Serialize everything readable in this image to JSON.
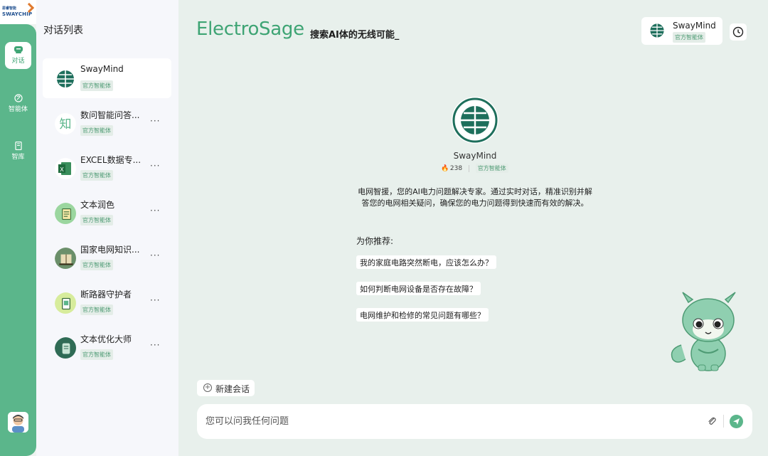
{
  "rail": {
    "logo_top": "思睿智能",
    "logo_bottom": "SWAYCHIP",
    "items": [
      {
        "label": "对话",
        "icon": "chat-icon",
        "active": true
      },
      {
        "label": "智能体",
        "icon": "brain-icon",
        "active": false
      },
      {
        "label": "智库",
        "icon": "book-icon",
        "active": false
      }
    ]
  },
  "sidebar": {
    "title": "对话列表",
    "conversations": [
      {
        "name": "SwayMind",
        "tag": "官方智能体",
        "active": true
      },
      {
        "name": "数问智能问答...",
        "tag": "官方智能体"
      },
      {
        "name": "EXCEL数据专...",
        "tag": "官方智能体"
      },
      {
        "name": "文本润色",
        "tag": "官方智能体"
      },
      {
        "name": "国家电网知识...",
        "tag": "官方智能体"
      },
      {
        "name": "断路器守护者",
        "tag": "官方智能体"
      },
      {
        "name": "文本优化大师",
        "tag": "官方智能体"
      }
    ],
    "more_label": "···"
  },
  "header": {
    "brand": "ElectroSage",
    "tagline": "搜索AI体的无线可能_",
    "agent_name": "SwayMind",
    "agent_tag": "官方智能体"
  },
  "intro": {
    "name": "SwayMind",
    "count": "238",
    "tag": "官方智能体",
    "description": "电网智援，您的AI电力问题解决专家。通过实时对话，精准识别并解答您的电网相关疑问，确保您的电力问题得到快速而有效的解决。"
  },
  "recommend": {
    "title": "为你推荐:",
    "items": [
      "我的家庭电路突然断电，应该怎么办？",
      "如何判断电网设备是否存在故障？",
      "电网维护和检修的常见问题有哪些？"
    ]
  },
  "bottom": {
    "new_chat": "新建会话",
    "placeholder": "您可以问我任何问题"
  },
  "colors": {
    "accent": "#5bb68b",
    "brand": "#3ea474",
    "background": "#e8f0ec",
    "sidebar": "#f6f7fb"
  }
}
